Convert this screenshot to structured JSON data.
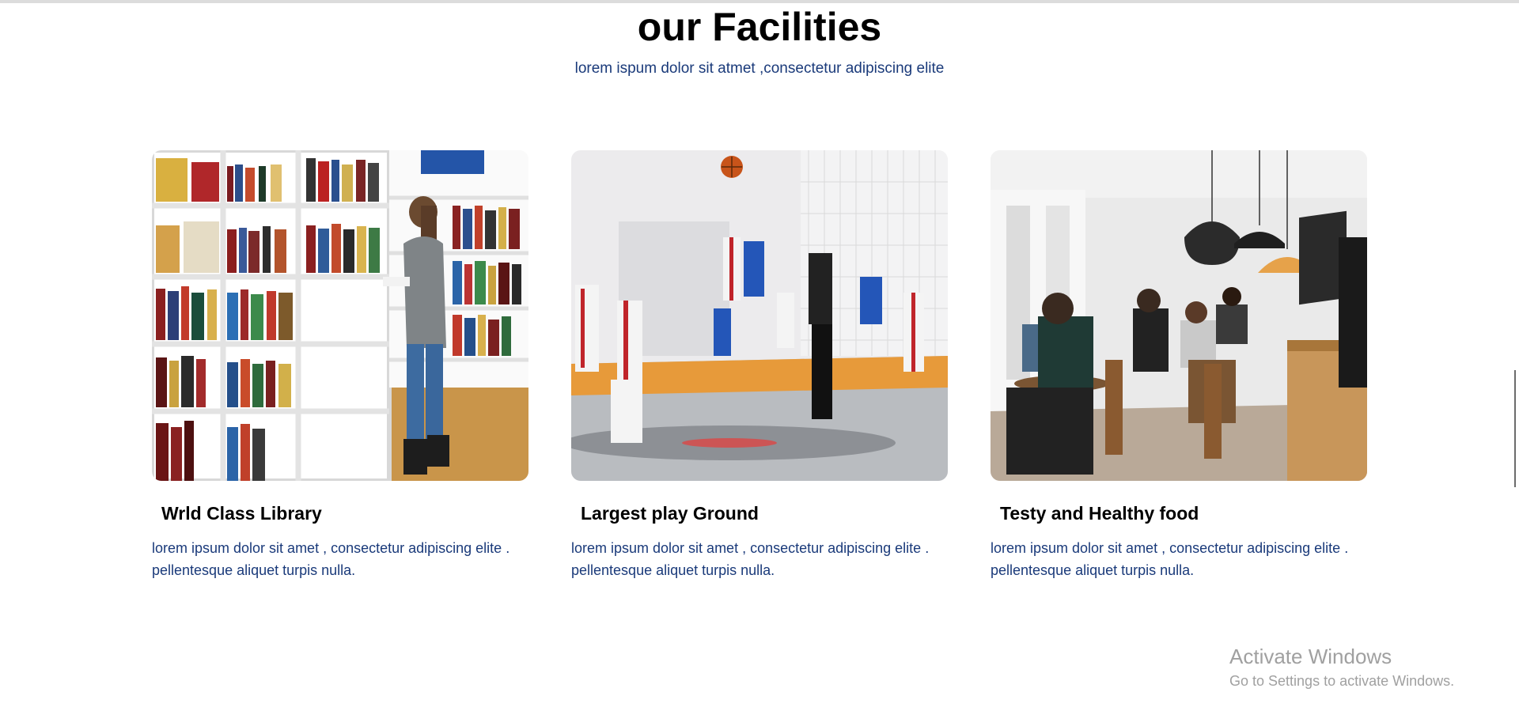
{
  "section": {
    "title": "our Facilities",
    "subtitle": "lorem ispum dolor sit atmet ,consectetur adipiscing elite"
  },
  "cards": [
    {
      "image_icon": "library-bookshelf-photo",
      "title": "Wrld Class Library",
      "text": "lorem ipsum dolor sit amet , consectetur adipiscing elite . pellentesque aliquet turpis nulla."
    },
    {
      "image_icon": "basketball-court-photo",
      "title": "Largest play Ground",
      "text": "lorem ipsum dolor sit amet , consectetur adipiscing elite . pellentesque aliquet turpis nulla."
    },
    {
      "image_icon": "cafe-dining-photo",
      "title": "Testy and Healthy food",
      "text": "lorem ipsum dolor sit amet , consectetur adipiscing elite . pellentesque aliquet turpis nulla."
    }
  ],
  "watermark": {
    "line1": "Activate Windows",
    "line2": "Go to Settings to activate Windows."
  },
  "colors": {
    "text_blue": "#1a3a7a",
    "heading": "#000000",
    "watermark": "#a0a0a0"
  }
}
